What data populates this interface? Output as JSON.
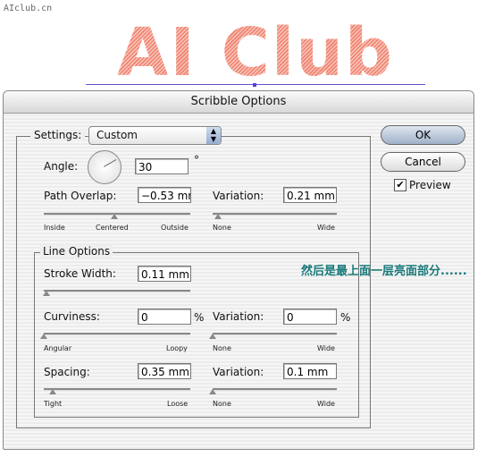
{
  "watermark": "AIclub.cn",
  "artwork_text": "AI Club",
  "dialog": {
    "title": "Scribble Options",
    "settings": {
      "label": "Settings:",
      "value": "Custom"
    },
    "angle": {
      "label": "Angle:",
      "value": "30",
      "unit": "°"
    },
    "path_overlap": {
      "label": "Path Overlap:",
      "value": "−0.53 mm",
      "slider_labels": [
        "Inside",
        "Centered",
        "Outside"
      ],
      "slider_position": 0.48
    },
    "path_overlap_variation": {
      "label": "Variation:",
      "value": "0.21 mm",
      "slider_labels": [
        "None",
        "Wide"
      ],
      "slider_position": 0.04
    },
    "line_options": {
      "title": "Line Options",
      "stroke_width": {
        "label": "Stroke Width:",
        "value": "0.11 mm",
        "slider_position": 0.02
      },
      "curviness": {
        "label": "Curviness:",
        "value": "0",
        "unit": "%",
        "slider_labels": [
          "Angular",
          "Loopy"
        ],
        "slider_position": 0.0
      },
      "curviness_variation": {
        "label": "Variation:",
        "value": "0",
        "unit": "%",
        "slider_labels": [
          "None",
          "Wide"
        ],
        "slider_position": 0.0
      },
      "spacing": {
        "label": "Spacing:",
        "value": "0.35 mm",
        "slider_labels": [
          "Tight",
          "Loose"
        ],
        "slider_position": 0.06
      },
      "spacing_variation": {
        "label": "Variation:",
        "value": "0.1 mm",
        "slider_labels": [
          "None",
          "Wide"
        ],
        "slider_position": 0.0
      }
    },
    "buttons": {
      "ok": "OK",
      "cancel": "Cancel"
    },
    "preview": {
      "label": "Preview",
      "checked": true
    }
  },
  "annotation": "然后是最上面一层亮面部分......",
  "colors": {
    "annotation": "#1a7a7a",
    "ok_button": "#b8c6da",
    "artwork": "#f08a78"
  }
}
